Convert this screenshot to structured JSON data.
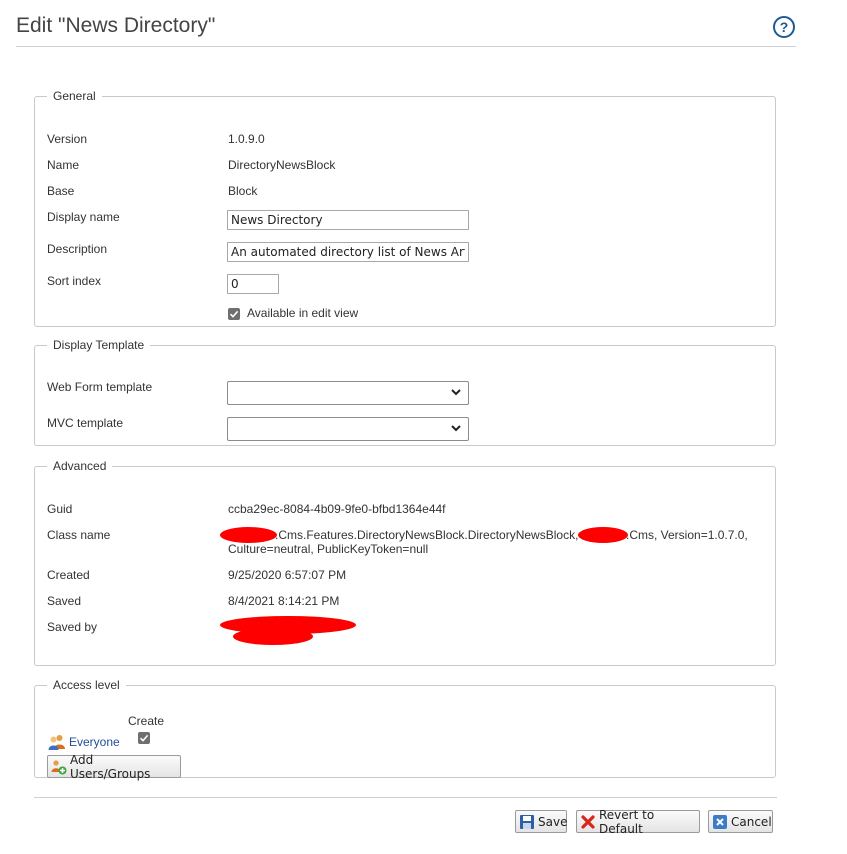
{
  "header": {
    "title": "Edit \"News Directory\"",
    "help_icon": "help-icon"
  },
  "general": {
    "legend": "General",
    "version_label": "Version",
    "version_value": "1.0.9.0",
    "name_label": "Name",
    "name_value": "DirectoryNewsBlock",
    "base_label": "Base",
    "base_value": "Block",
    "display_name_label": "Display name",
    "display_name_value": "News Directory",
    "description_label": "Description",
    "description_value": "An automated directory list of News Articles",
    "sort_index_label": "Sort index",
    "sort_index_value": "0",
    "available_label": "Available in edit view",
    "available_checked": true
  },
  "display_template": {
    "legend": "Display Template",
    "webform_label": "Web Form template",
    "webform_value": "",
    "mvc_label": "MVC template",
    "mvc_value": ""
  },
  "advanced": {
    "legend": "Advanced",
    "guid_label": "Guid",
    "guid_value": "ccba29ec-8084-4b09-9fe0-bfbd1364e44f",
    "class_label": "Class name",
    "class_part1": ".Cms.Features.DirectoryNewsBlock.DirectoryNewsBlock,",
    "class_part2": ".Cms, Version=1.0.7.0,",
    "class_part3": "Culture=neutral, PublicKeyToken=null",
    "created_label": "Created",
    "created_value": "9/25/2020 6:57:07 PM",
    "saved_label": "Saved",
    "saved_value": "8/4/2021 8:14:21 PM",
    "saved_by_label": "Saved by",
    "redaction_color": "#ff0000"
  },
  "access": {
    "legend": "Access level",
    "column_create": "Create",
    "row_everyone": "Everyone",
    "everyone_create_checked": true,
    "add_button": "Add Users/Groups"
  },
  "footer": {
    "save_label": "Save",
    "revert_label": "Revert to Default",
    "cancel_label": "Cancel"
  },
  "colors": {
    "link": "#1f4e96",
    "help": "#1f5a96"
  }
}
